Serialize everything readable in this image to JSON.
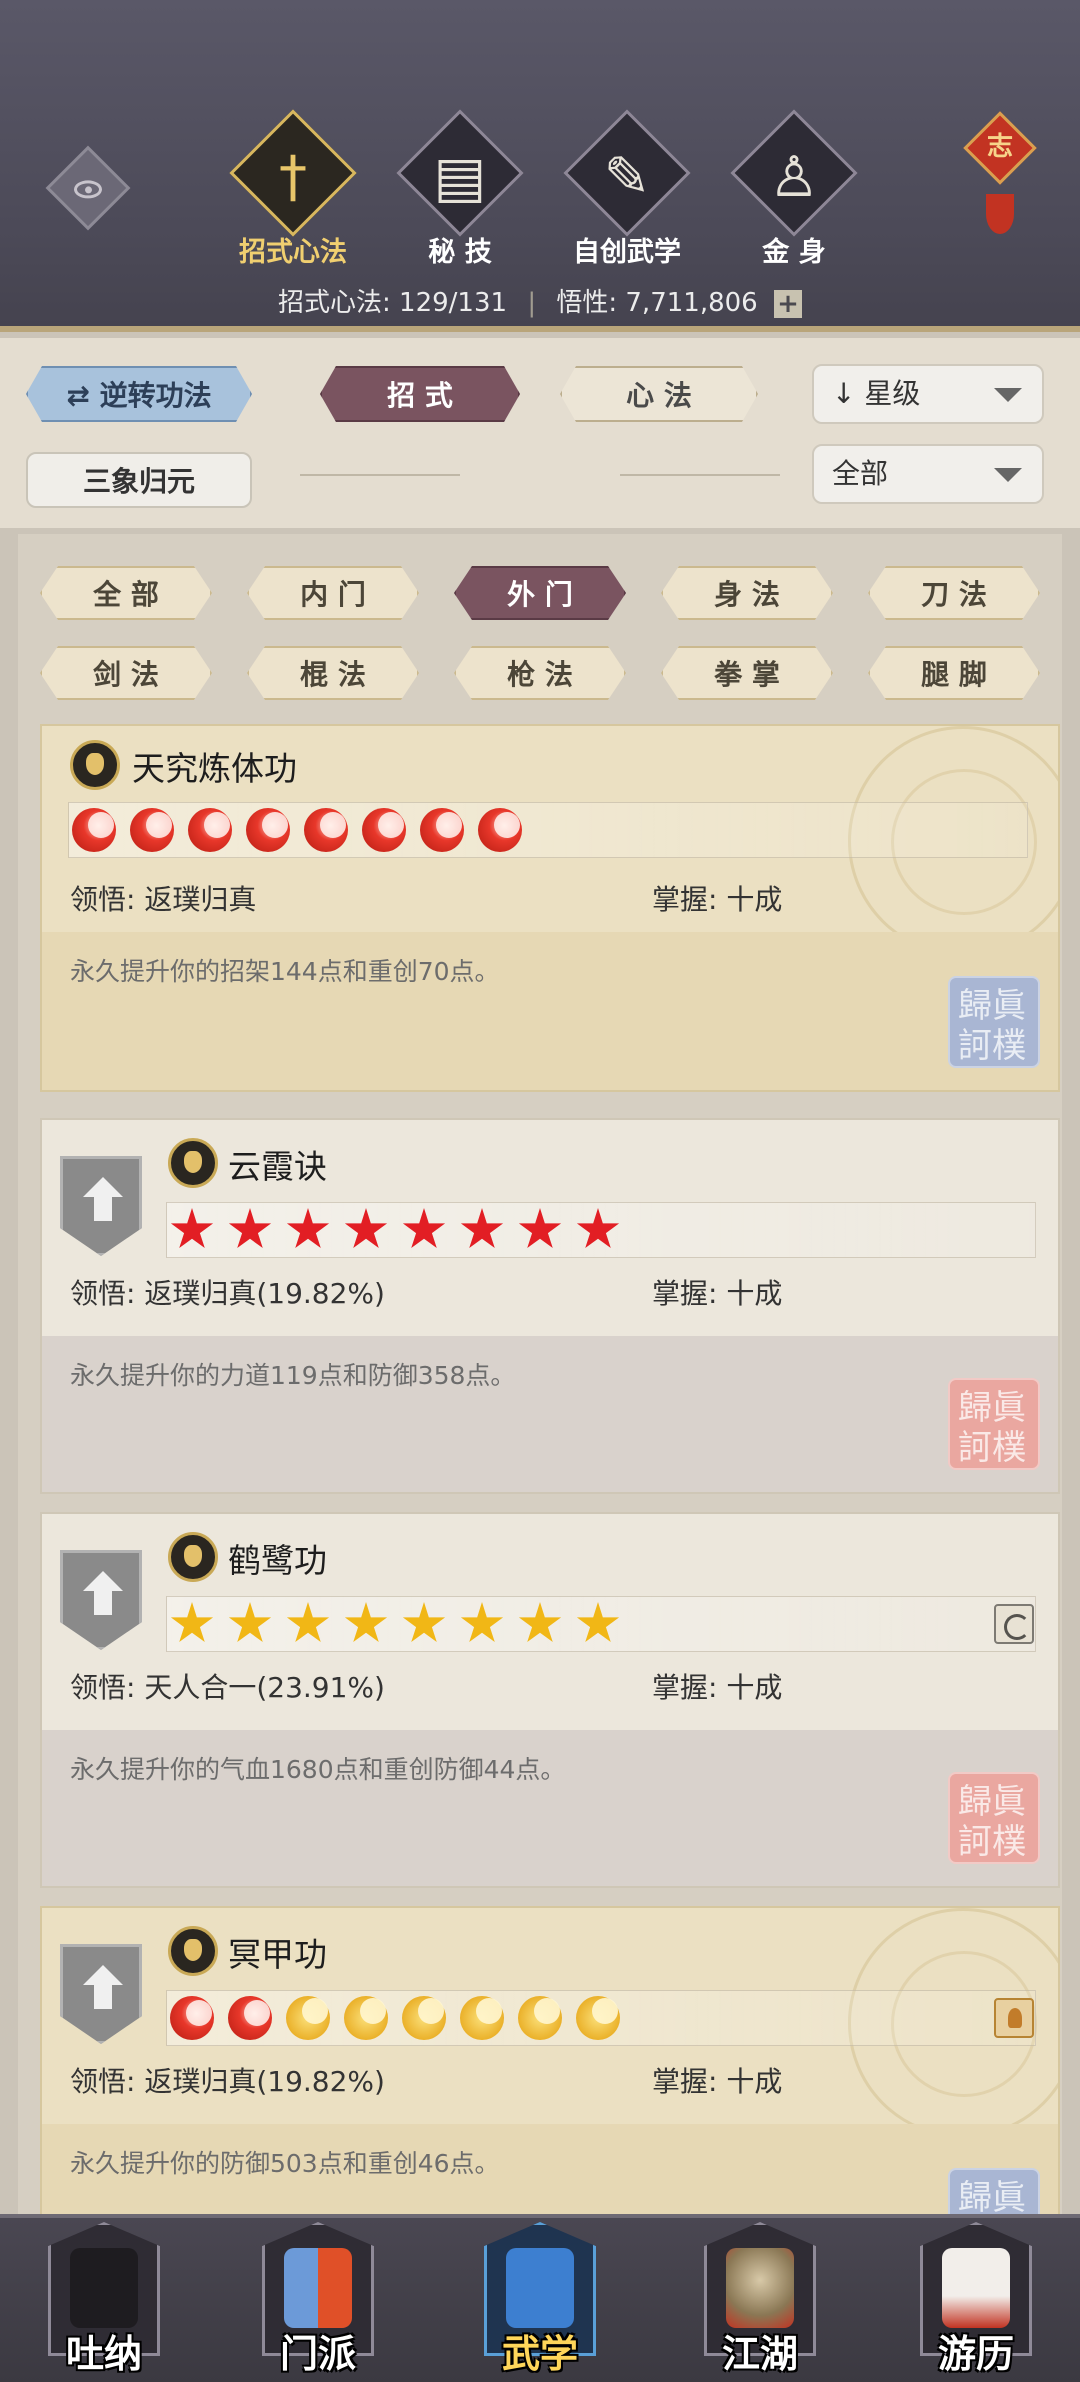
{
  "header": {
    "tabs": [
      {
        "label": "招式心法",
        "icon": "sword-icon",
        "glyph": "†"
      },
      {
        "label": "秘 技",
        "icon": "book-icon",
        "glyph": "▤"
      },
      {
        "label": "自创武学",
        "icon": "scroll-icon",
        "glyph": "✎"
      },
      {
        "label": "金 身",
        "icon": "meditation-icon",
        "glyph": "♙"
      }
    ],
    "knot_char": "志",
    "stats_label": "招式心法: 129/131",
    "wisdom_label": "悟性: 7,711,806",
    "plus": "+"
  },
  "filters": {
    "reverse_btn": "⇄ 逆转功法",
    "moves_tab": "招 式",
    "heart_tab": "心 法",
    "sort_dropdown": "↓ 星级",
    "sanxiang_btn": "三象归元",
    "filter_dropdown": "全部"
  },
  "categories": [
    "全 部",
    "内 门",
    "外 门",
    "身 法",
    "刀 法",
    "剑 法",
    "棍 法",
    "枪 法",
    "拳 掌",
    "腿 脚"
  ],
  "active_category": 2,
  "skills": [
    {
      "name": "天究炼体功",
      "stars": "8 flame",
      "insight_label": "领悟:  返璞归真",
      "mastery_label": "掌握:  十成",
      "desc": "永久提升你的招架144点和重创70点。",
      "seal": "歸眞 訶樸"
    },
    {
      "name": "云霞诀",
      "stars": "8 red star",
      "insight_label": "领悟:  返璞归真(19.82%)",
      "mastery_label": "掌握:  十成",
      "desc": "永久提升你的力道119点和防御358点。",
      "seal": "歸眞 訶樸"
    },
    {
      "name": "鹤鹭功",
      "stars": "8 gold star",
      "insight_label": "领悟:  天人合一(23.91%)",
      "mastery_label": "掌握:  十成",
      "desc": "永久提升你的气血1680点和重创防御44点。",
      "seal": "歸眞 訶樸"
    },
    {
      "name": "冥甲功",
      "stars": "2 flame + 6 moon",
      "insight_label": "领悟:  返璞归真(19.82%)",
      "mastery_label": "掌握:  十成",
      "desc": "永久提升你的防御503点和重创46点。",
      "seal": "歸眞"
    }
  ],
  "bottom_nav": [
    {
      "label": "吐纳",
      "icon": "figure-icon"
    },
    {
      "label": "门派",
      "icon": "sect-banner-icon"
    },
    {
      "label": "武学",
      "icon": "manual-book-icon"
    },
    {
      "label": "江湖",
      "icon": "straw-hat-icon"
    },
    {
      "label": "游历",
      "icon": "horse-icon"
    }
  ],
  "colors": {
    "header_bg": "#4c4a58",
    "active_gold": "#e8c66a",
    "maroon_tab": "#7a5460",
    "blue_tab": "#a8c2dc",
    "flame_red": "#e8372a",
    "star_gold": "#f1b716"
  }
}
